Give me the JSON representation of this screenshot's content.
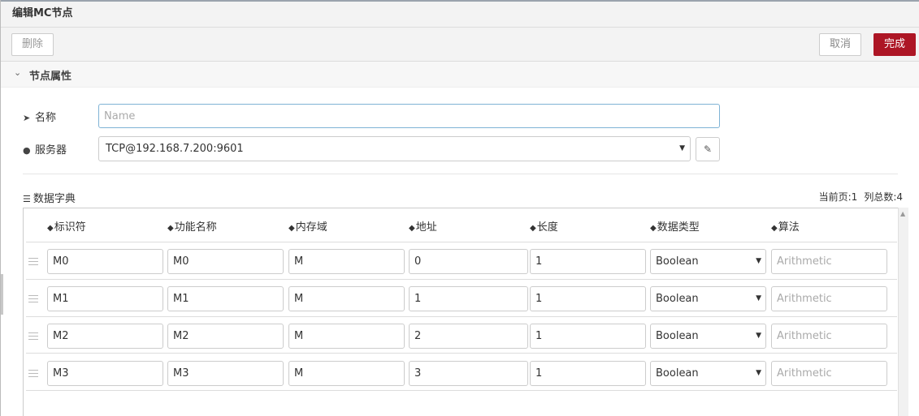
{
  "title": "编辑MC节点",
  "toolbar": {
    "delete_label": "删除",
    "cancel_label": "取消",
    "done_label": "完成"
  },
  "section": {
    "title": "节点属性"
  },
  "form": {
    "name_label": "名称",
    "name_placeholder": "Name",
    "name_value": "",
    "server_label": "服务器",
    "server_value": "TCP@192.168.7.200:9601"
  },
  "dictionary": {
    "title": "数据字典",
    "current_page": "当前页:1",
    "column_count": "列总数:4",
    "columns": [
      "标识符",
      "功能名称",
      "内存域",
      "地址",
      "长度",
      "数据类型",
      "算法"
    ],
    "algorithm_placeholder": "Arithmetic",
    "rows": [
      {
        "id": "M0",
        "name": "M0",
        "memory": "M",
        "address": "0",
        "length": "1",
        "type": "Boolean",
        "algorithm": ""
      },
      {
        "id": "M1",
        "name": "M1",
        "memory": "M",
        "address": "1",
        "length": "1",
        "type": "Boolean",
        "algorithm": ""
      },
      {
        "id": "M2",
        "name": "M2",
        "memory": "M",
        "address": "2",
        "length": "1",
        "type": "Boolean",
        "algorithm": ""
      },
      {
        "id": "M3",
        "name": "M3",
        "memory": "M",
        "address": "3",
        "length": "1",
        "type": "Boolean",
        "algorithm": ""
      }
    ]
  },
  "colors": {
    "accent": "#ad1625",
    "focus_border": "#7fb3d5"
  },
  "icons": {
    "tag": "tag-icon",
    "globe": "globe-icon",
    "list": "list-icon",
    "pencil": "pencil-icon",
    "chevron": "chevron-down-icon",
    "drag": "drag-handle-icon"
  }
}
